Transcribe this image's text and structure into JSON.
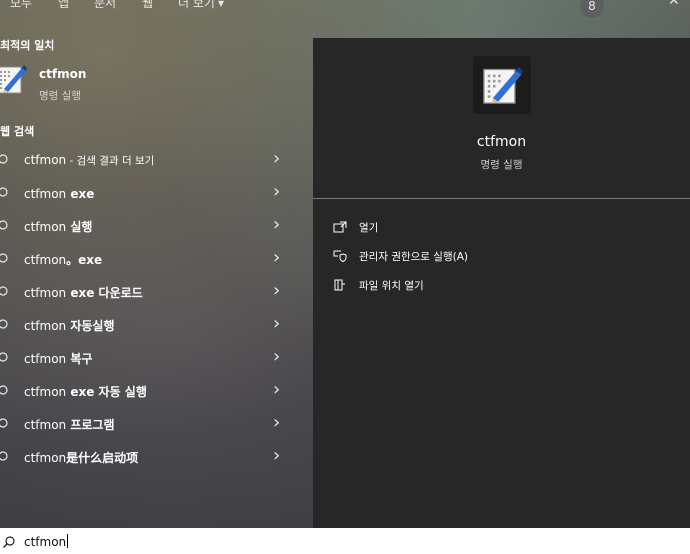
{
  "topbar": {
    "tabs": [
      "모두",
      "앱",
      "문서",
      "웹",
      "더 보기"
    ],
    "more_chevron": "▾",
    "avatar_letter": "8",
    "more_options_glyph": "···",
    "close_glyph": "✕"
  },
  "best_match": {
    "heading": "최적의 일치",
    "name": "ctfmon",
    "type": "명령 실행"
  },
  "web_search": {
    "heading": "웹 검색",
    "items": [
      {
        "prefix": "ctfmon",
        "suffix": " - 검색 결과 더 보기",
        "bold_suffix": false
      },
      {
        "prefix": "ctfmon",
        "suffix": " exe",
        "bold_suffix": true
      },
      {
        "prefix": "ctfmon",
        "suffix": " 실행",
        "bold_suffix": true
      },
      {
        "prefix": "ctfmon",
        "suffix": "。exe",
        "bold_suffix": true
      },
      {
        "prefix": "ctfmon",
        "suffix": " exe 다운로드",
        "bold_suffix": true
      },
      {
        "prefix": "ctfmon",
        "suffix": " 자동실행",
        "bold_suffix": true
      },
      {
        "prefix": "ctfmon",
        "suffix": " 복구",
        "bold_suffix": true
      },
      {
        "prefix": "ctfmon",
        "suffix": " exe 자동 실행",
        "bold_suffix": true
      },
      {
        "prefix": "ctfmon",
        "suffix": " 프로그램",
        "bold_suffix": true
      },
      {
        "prefix": "ctfmon",
        "suffix": "是什么启动项",
        "bold_suffix": true
      }
    ]
  },
  "preview": {
    "title": "ctfmon",
    "subtitle": "명령 실행",
    "actions": [
      {
        "icon": "open-icon",
        "label": "열기"
      },
      {
        "icon": "admin-shield-icon",
        "label": "관리자 권한으로 실행(A)"
      },
      {
        "icon": "folder-location-icon",
        "label": "파일 위치 열기"
      }
    ]
  },
  "search": {
    "query": "ctfmon"
  },
  "colors": {
    "preview_bg": "#272727",
    "search_bg": "#ffffff"
  }
}
